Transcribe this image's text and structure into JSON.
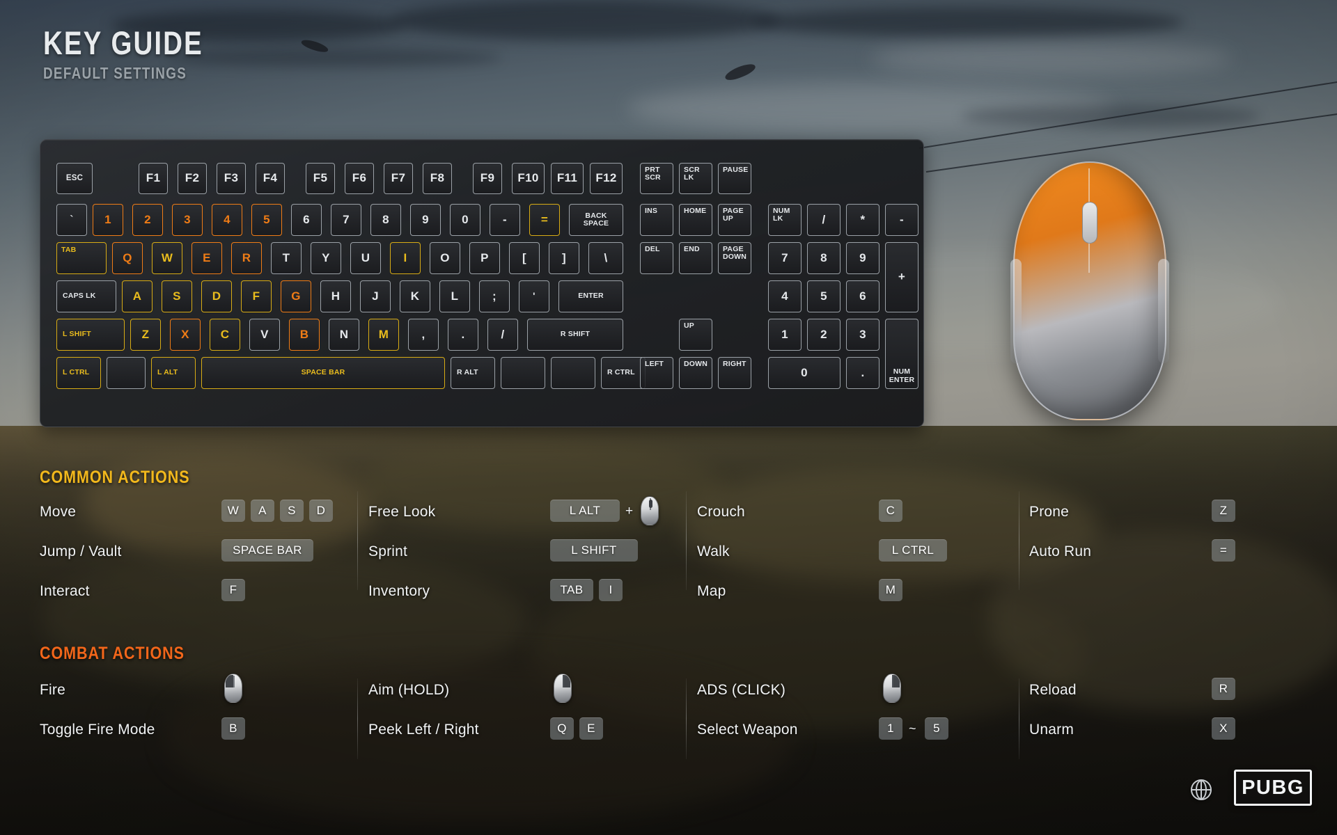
{
  "header": {
    "title": "KEY GUIDE",
    "subtitle": "DEFAULT SETTINGS"
  },
  "keyboard": {
    "rows": {
      "function_row": [
        {
          "label": "ESC",
          "hl": "none"
        },
        {
          "label": "F1",
          "hl": "none"
        },
        {
          "label": "F2",
          "hl": "none"
        },
        {
          "label": "F3",
          "hl": "none"
        },
        {
          "label": "F4",
          "hl": "none"
        },
        {
          "label": "F5",
          "hl": "none"
        },
        {
          "label": "F6",
          "hl": "none"
        },
        {
          "label": "F7",
          "hl": "none"
        },
        {
          "label": "F8",
          "hl": "none"
        },
        {
          "label": "F9",
          "hl": "none"
        },
        {
          "label": "F10",
          "hl": "none"
        },
        {
          "label": "F11",
          "hl": "none"
        },
        {
          "label": "F12",
          "hl": "none"
        },
        {
          "label": "PRT SCR",
          "hl": "none"
        },
        {
          "label": "SCR LK",
          "hl": "none"
        },
        {
          "label": "PAUSE",
          "hl": "none"
        }
      ],
      "number_row": [
        {
          "label": "`",
          "hl": "none"
        },
        {
          "label": "1",
          "hl": "orange"
        },
        {
          "label": "2",
          "hl": "orange"
        },
        {
          "label": "3",
          "hl": "orange"
        },
        {
          "label": "4",
          "hl": "orange"
        },
        {
          "label": "5",
          "hl": "orange"
        },
        {
          "label": "6",
          "hl": "none"
        },
        {
          "label": "7",
          "hl": "none"
        },
        {
          "label": "8",
          "hl": "none"
        },
        {
          "label": "9",
          "hl": "none"
        },
        {
          "label": "0",
          "hl": "none"
        },
        {
          "label": "-",
          "hl": "none"
        },
        {
          "label": "=",
          "hl": "gold"
        },
        {
          "label": "BACK SPACE",
          "hl": "none"
        },
        {
          "label": "INS",
          "hl": "none"
        },
        {
          "label": "HOME",
          "hl": "none"
        },
        {
          "label": "PAGE UP",
          "hl": "none"
        },
        {
          "label": "NUM LK",
          "hl": "none"
        },
        {
          "label": "/",
          "hl": "none"
        },
        {
          "label": "*",
          "hl": "none"
        },
        {
          "label": "-",
          "hl": "none"
        }
      ],
      "qwerty_row": [
        {
          "label": "TAB",
          "hl": "gold"
        },
        {
          "label": "Q",
          "hl": "orange"
        },
        {
          "label": "W",
          "hl": "gold"
        },
        {
          "label": "E",
          "hl": "orange"
        },
        {
          "label": "R",
          "hl": "orange"
        },
        {
          "label": "T",
          "hl": "none"
        },
        {
          "label": "Y",
          "hl": "none"
        },
        {
          "label": "U",
          "hl": "none"
        },
        {
          "label": "I",
          "hl": "gold"
        },
        {
          "label": "O",
          "hl": "none"
        },
        {
          "label": "P",
          "hl": "none"
        },
        {
          "label": "[",
          "hl": "none"
        },
        {
          "label": "]",
          "hl": "none"
        },
        {
          "label": "\\",
          "hl": "none"
        },
        {
          "label": "DEL",
          "hl": "none"
        },
        {
          "label": "END",
          "hl": "none"
        },
        {
          "label": "PAGE DOWN",
          "hl": "none"
        },
        {
          "label": "7",
          "hl": "none"
        },
        {
          "label": "8",
          "hl": "none"
        },
        {
          "label": "9",
          "hl": "none"
        },
        {
          "label": "+",
          "hl": "none"
        }
      ],
      "home_row": [
        {
          "label": "CAPS LK",
          "hl": "none"
        },
        {
          "label": "A",
          "hl": "gold"
        },
        {
          "label": "S",
          "hl": "gold"
        },
        {
          "label": "D",
          "hl": "gold"
        },
        {
          "label": "F",
          "hl": "gold"
        },
        {
          "label": "G",
          "hl": "orange"
        },
        {
          "label": "H",
          "hl": "none"
        },
        {
          "label": "J",
          "hl": "none"
        },
        {
          "label": "K",
          "hl": "none"
        },
        {
          "label": "L",
          "hl": "none"
        },
        {
          "label": ";",
          "hl": "none"
        },
        {
          "label": "'",
          "hl": "none"
        },
        {
          "label": "ENTER",
          "hl": "none"
        },
        {
          "label": "4",
          "hl": "none"
        },
        {
          "label": "5",
          "hl": "none"
        },
        {
          "label": "6",
          "hl": "none"
        }
      ],
      "shift_row": [
        {
          "label": "L SHIFT",
          "hl": "gold"
        },
        {
          "label": "Z",
          "hl": "gold"
        },
        {
          "label": "X",
          "hl": "orange"
        },
        {
          "label": "C",
          "hl": "gold"
        },
        {
          "label": "V",
          "hl": "none"
        },
        {
          "label": "B",
          "hl": "orange"
        },
        {
          "label": "N",
          "hl": "none"
        },
        {
          "label": "M",
          "hl": "gold"
        },
        {
          "label": ",",
          "hl": "none"
        },
        {
          "label": ".",
          "hl": "none"
        },
        {
          "label": "/",
          "hl": "none"
        },
        {
          "label": "R SHIFT",
          "hl": "none"
        },
        {
          "label": "UP",
          "hl": "none"
        },
        {
          "label": "1",
          "hl": "none"
        },
        {
          "label": "2",
          "hl": "none"
        },
        {
          "label": "3",
          "hl": "none"
        },
        {
          "label": "NUM ENTER",
          "hl": "none"
        }
      ],
      "bottom_row": [
        {
          "label": "L CTRL",
          "hl": "gold"
        },
        {
          "label": "",
          "hl": "none"
        },
        {
          "label": "L ALT",
          "hl": "gold"
        },
        {
          "label": "SPACE BAR",
          "hl": "gold"
        },
        {
          "label": "R ALT",
          "hl": "none"
        },
        {
          "label": "",
          "hl": "none"
        },
        {
          "label": "",
          "hl": "none"
        },
        {
          "label": "R CTRL",
          "hl": "none"
        },
        {
          "label": "LEFT",
          "hl": "none"
        },
        {
          "label": "DOWN",
          "hl": "none"
        },
        {
          "label": "RIGHT",
          "hl": "none"
        },
        {
          "label": "0",
          "hl": "none"
        },
        {
          "label": ".",
          "hl": "none"
        }
      ]
    }
  },
  "common_actions": {
    "title": "COMMON ACTIONS",
    "rows": [
      {
        "label": "Move",
        "keys": [
          "W",
          "A",
          "S",
          "D"
        ]
      },
      {
        "label": "Jump / Vault",
        "keys": [
          "SPACE BAR"
        ]
      },
      {
        "label": "Interact",
        "keys": [
          "F"
        ]
      },
      {
        "label": "Free Look",
        "keys": [
          "L ALT"
        ],
        "connector": "+",
        "mouse": "mouse-wheel"
      },
      {
        "label": "Sprint",
        "keys": [
          "L SHIFT"
        ]
      },
      {
        "label": "Inventory",
        "keys": [
          "TAB",
          "I"
        ]
      },
      {
        "label": "Crouch",
        "keys": [
          "C"
        ]
      },
      {
        "label": "Walk",
        "keys": [
          "L CTRL"
        ]
      },
      {
        "label": "Map",
        "keys": [
          "M"
        ]
      },
      {
        "label": "Prone",
        "keys": [
          "Z"
        ]
      },
      {
        "label": "Auto Run",
        "keys": [
          "="
        ]
      }
    ]
  },
  "combat_actions": {
    "title": "COMBAT ACTIONS",
    "rows": [
      {
        "label": "Fire",
        "keys": [],
        "mouse": "mouse-left"
      },
      {
        "label": "Toggle Fire Mode",
        "keys": [
          "B"
        ]
      },
      {
        "label": "Aim (HOLD)",
        "keys": [],
        "mouse": "mouse-right"
      },
      {
        "label": "Peek Left / Right",
        "keys": [
          "Q",
          "E"
        ]
      },
      {
        "label": "ADS (CLICK)",
        "keys": [],
        "mouse": "mouse-right"
      },
      {
        "label": "Select Weapon",
        "keys": [
          "1",
          "5"
        ],
        "connector": "~"
      },
      {
        "label": "Reload",
        "keys": [
          "R"
        ]
      },
      {
        "label": "Unarm",
        "keys": [
          "X"
        ]
      }
    ]
  },
  "footer": {
    "logo": "PUBG",
    "globe_label": "globe-icon"
  },
  "colors": {
    "highlight_orange": "#ef7c16",
    "highlight_gold": "#d8ac15",
    "section_gold": "#f2b81c",
    "section_orange": "#f2661a"
  }
}
